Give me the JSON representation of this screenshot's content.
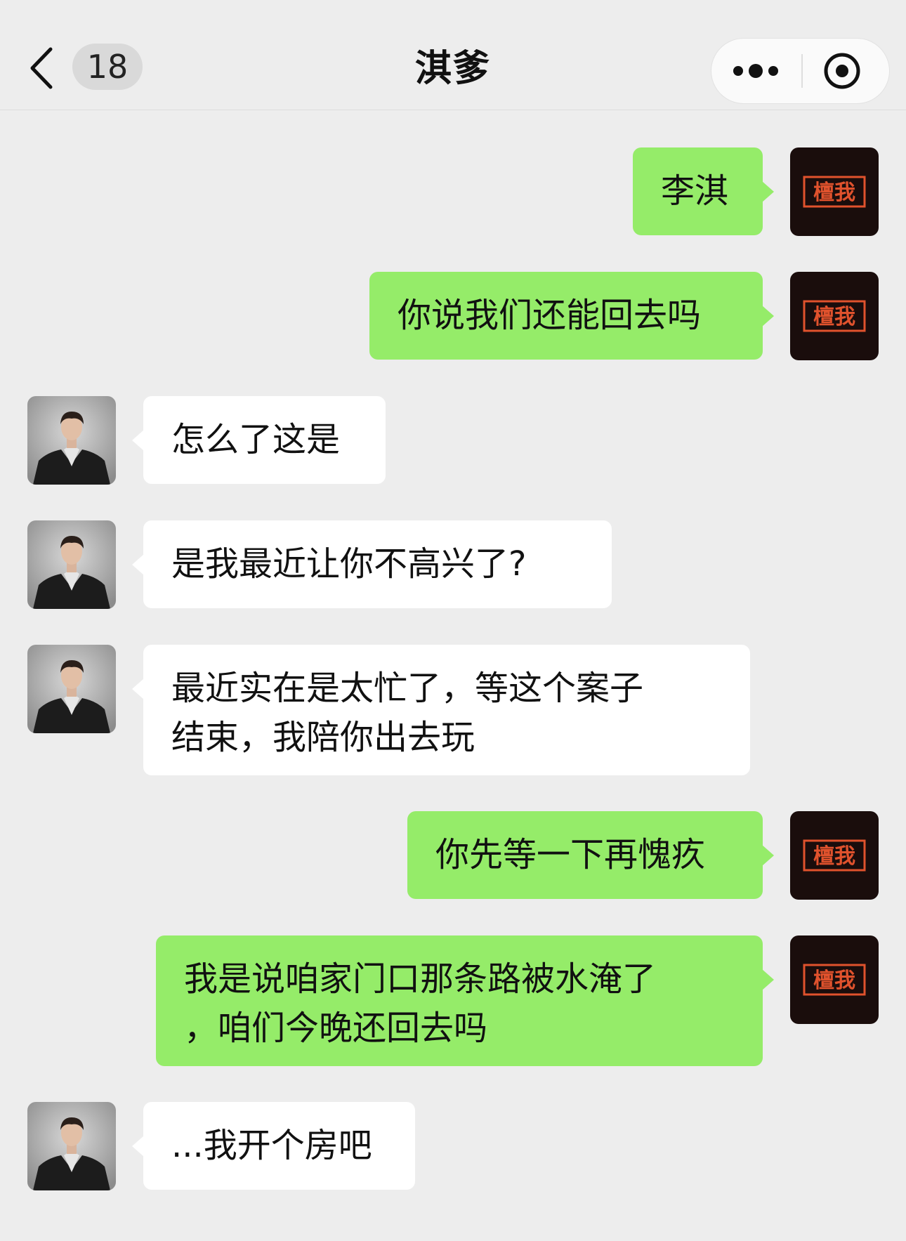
{
  "header": {
    "title": "淇爹",
    "unread_count": "18",
    "back_icon": "chevron-left-icon",
    "more_icon": "more-dots-icon",
    "close_icon": "target-close-icon"
  },
  "self_avatar": {
    "text": "檀我",
    "bg_color": "#1a0d0c",
    "text_color": "#e0522d"
  },
  "colors": {
    "background": "#ededed",
    "outgoing_bubble": "#95ec69",
    "incoming_bubble": "#ffffff"
  },
  "messages": [
    {
      "side": "out",
      "text": "李淇"
    },
    {
      "side": "out",
      "text": "你说我们还能回去吗"
    },
    {
      "side": "in",
      "text": "怎么了这是"
    },
    {
      "side": "in",
      "text": "是我最近让你不高兴了?"
    },
    {
      "side": "in",
      "text": "最近实在是太忙了，等这个案子\n结束，我陪你出去玩"
    },
    {
      "side": "out",
      "text": "你先等一下再愧疚"
    },
    {
      "side": "out",
      "text": "我是说咱家门口那条路被水淹了\n，咱们今晚还回去吗"
    },
    {
      "side": "in",
      "text": "...我开个房吧"
    }
  ]
}
